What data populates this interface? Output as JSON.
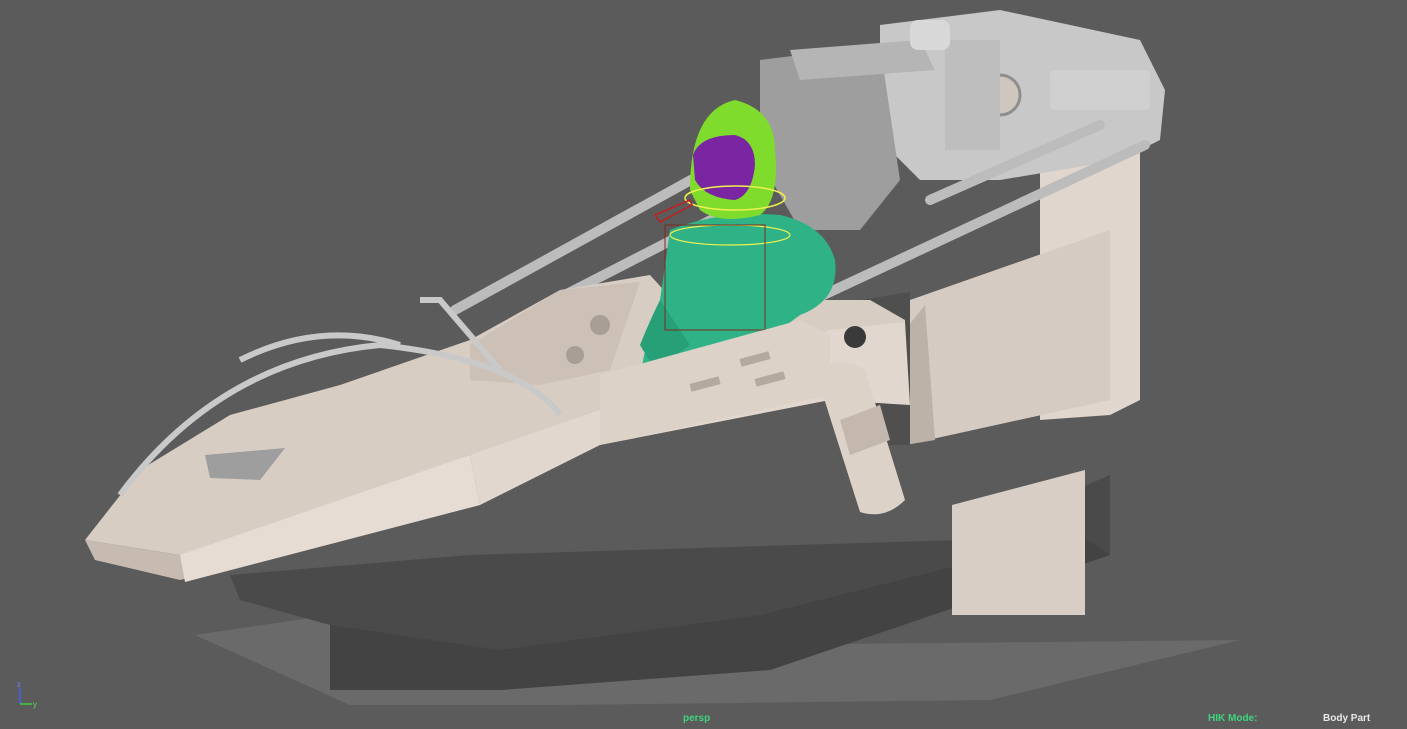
{
  "viewport": {
    "camera": "persp",
    "hik_mode_label": "HIK Mode:",
    "hik_mode_value": "Body Part",
    "background_color": "#5b5b5b"
  },
  "axis_gizmo": {
    "z_label": "z",
    "y_label": "y"
  },
  "colors": {
    "cockpit_shell": "#ddd2c8",
    "cockpit_shadow": "#b8aca2",
    "frame_gray": "#c4c4c4",
    "base_dark": "#4b4b4b",
    "pilot_body": "#2fb386",
    "helmet": "#7fdb2c",
    "visor": "#7a26a3",
    "hud_text": "#3fd47f"
  }
}
